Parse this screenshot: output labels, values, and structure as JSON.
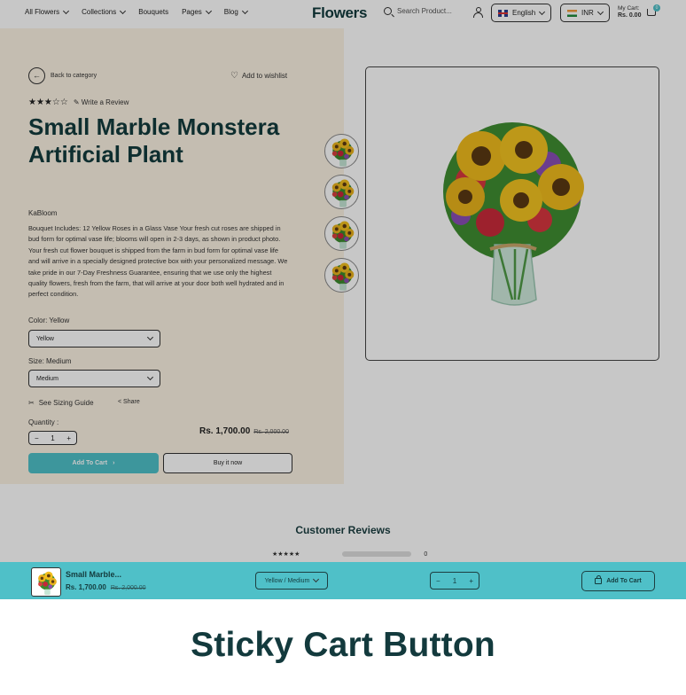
{
  "header": {
    "nav": [
      "All Flowers",
      "Collections",
      "Bouquets",
      "Pages",
      "Blog"
    ],
    "logo": "Flowers",
    "search_placeholder": "Search Product...",
    "language": "English",
    "currency": "INR",
    "cart_label": "My Cart:",
    "cart_total": "Rs. 0.00",
    "cart_count": "0"
  },
  "product": {
    "back_label": "Back to category",
    "wishlist_label": "Add to wishlist",
    "stars": "★★★☆☆",
    "write_review": "Write a Review",
    "title": "Small Marble Monstera Artificial Plant",
    "brand": "KaBloom",
    "description": "Bouquet Includes: 12 Yellow Roses in a Glass Vase Your fresh cut roses are shipped in bud form for optimal vase life; blooms will open in 2-3 days, as shown in product photo. Your fresh cut flower bouquet is shipped from the farm in bud form for optimal vase life and will arrive in a specially designed protective box with your personalized message. We take pride in our 7-Day Freshness Guarantee, ensuring that we use only the highest quality flowers, fresh from the farm, that will arrive at your door both well hydrated and in perfect condition.",
    "color_label": "Color: Yellow",
    "color_value": "Yellow",
    "size_label": "Size: Medium",
    "size_value": "Medium",
    "sizing_guide": "See Sizing Guide",
    "share": "Share",
    "quantity_label": "Quantity :",
    "quantity": "1",
    "price": "Rs. 1,700.00",
    "old_price": "Rs. 2,000.00",
    "add_to_cart": "Add To Cart",
    "buy_now": "Buy it now"
  },
  "reviews": {
    "title": "Customer Reviews",
    "row_stars": "★★★★★",
    "row_count": "0"
  },
  "sticky": {
    "title": "Small Marble...",
    "price": "Rs. 1,700.00",
    "old_price": "Rs. 2,000.00",
    "variant": "Yellow / Medium",
    "quantity": "1",
    "add_to_cart": "Add To Cart"
  },
  "caption": "Sticky Cart Button",
  "colors": {
    "accent": "#4fc0c8",
    "dark_teal": "#133a3d",
    "panel": "#fbf2e3"
  }
}
